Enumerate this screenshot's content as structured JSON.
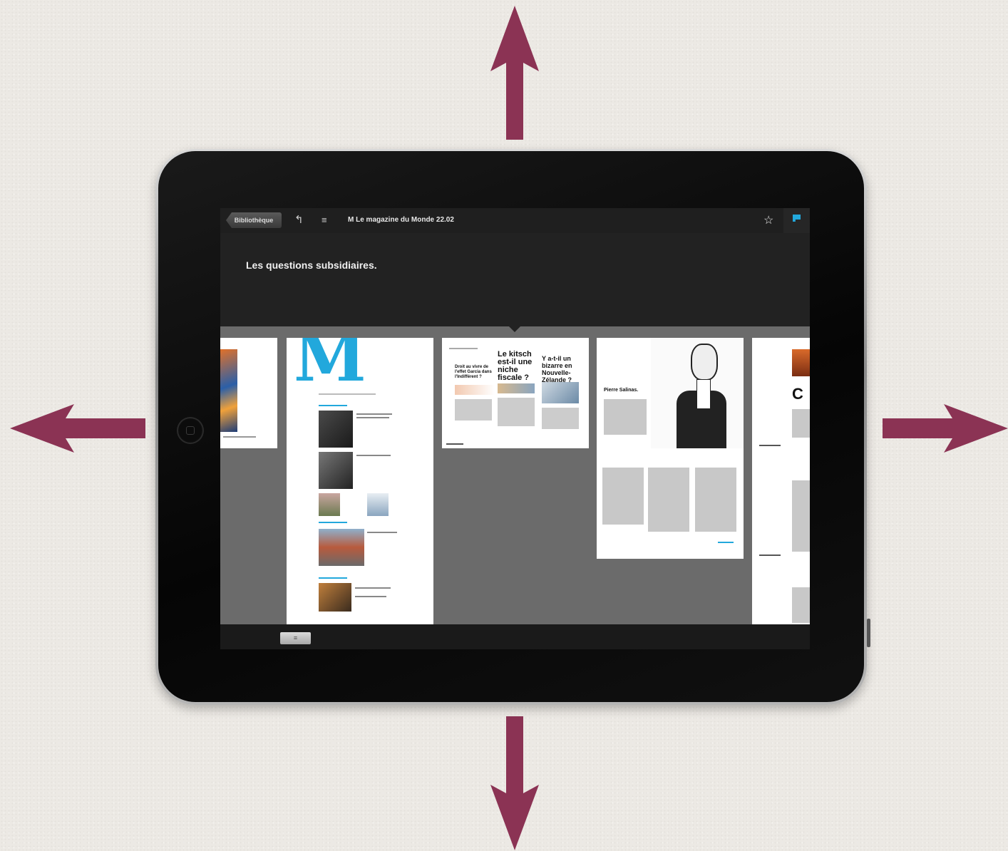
{
  "toolbar": {
    "back_label": "Bibliothèque",
    "title": "M Le magazine du Monde 22.02",
    "icons": [
      "undo-icon",
      "list-icon",
      "star-icon",
      "flag-icon"
    ]
  },
  "section": {
    "title": "Les questions subsidiaires."
  },
  "pages": {
    "headline_1": "Le kitsch est-il une niche fiscale ?",
    "headline_2": "Y a-t-il un bizarre en Nouvelle-Zélande ?",
    "headline_small": "Droit au vivre de l'effet Garcia dans l'Indifférent ?",
    "portrait_caption": "Pierre Salinas.",
    "logo_letter": "M",
    "right_letter": "C"
  },
  "bottombar": {
    "button_label": "≡"
  },
  "colors": {
    "arrow": "#8b3354",
    "accent_blue": "#22a8dc"
  }
}
